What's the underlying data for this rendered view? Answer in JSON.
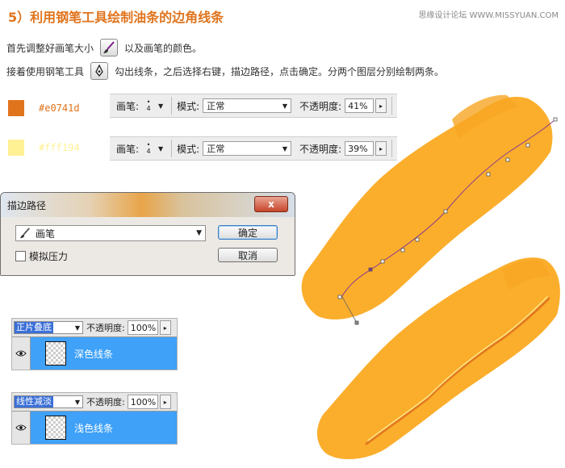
{
  "header": {
    "title": "5）利用钢笔工具绘制油条的边角线条",
    "watermark": "思缘设计论坛 WWW.MISSYUAN.COM"
  },
  "instructions": {
    "line1_a": "首先调整好画笔大小",
    "line1_b": "以及画笔的颜色。",
    "line2_a": "接着使用钢笔工具",
    "line2_b": "勾出线条，之后选择右键，描边路径，点击确定。分两个图层分别绘制两条。"
  },
  "colors": {
    "dark": "#e0741d",
    "light": "#fff194",
    "churro": "#fbae2c"
  },
  "swatches": [
    {
      "hex": "#e0741d"
    },
    {
      "hex": "#fff194"
    }
  ],
  "toolbars": [
    {
      "brush_label": "画笔:",
      "brush_size": "4",
      "mode_label": "模式:",
      "mode_value": "正常",
      "opacity_label": "不透明度:",
      "opacity_value": "41%"
    },
    {
      "brush_label": "画笔:",
      "brush_size": "4",
      "mode_label": "模式:",
      "mode_value": "正常",
      "opacity_label": "不透明度:",
      "opacity_value": "39%"
    }
  ],
  "dialog": {
    "title": "描边路径",
    "close": "x",
    "tool_value": "画笔",
    "simulate_pressure": "模拟压力",
    "ok": "确定",
    "cancel": "取消"
  },
  "layers": [
    {
      "blend_mode": "正片叠底",
      "opacity_label": "不透明度:",
      "opacity_value": "100%",
      "layer_name": "深色线条"
    },
    {
      "blend_mode": "线性减淡",
      "opacity_label": "不透明度:",
      "opacity_value": "100%",
      "layer_name": "浅色线条"
    }
  ]
}
